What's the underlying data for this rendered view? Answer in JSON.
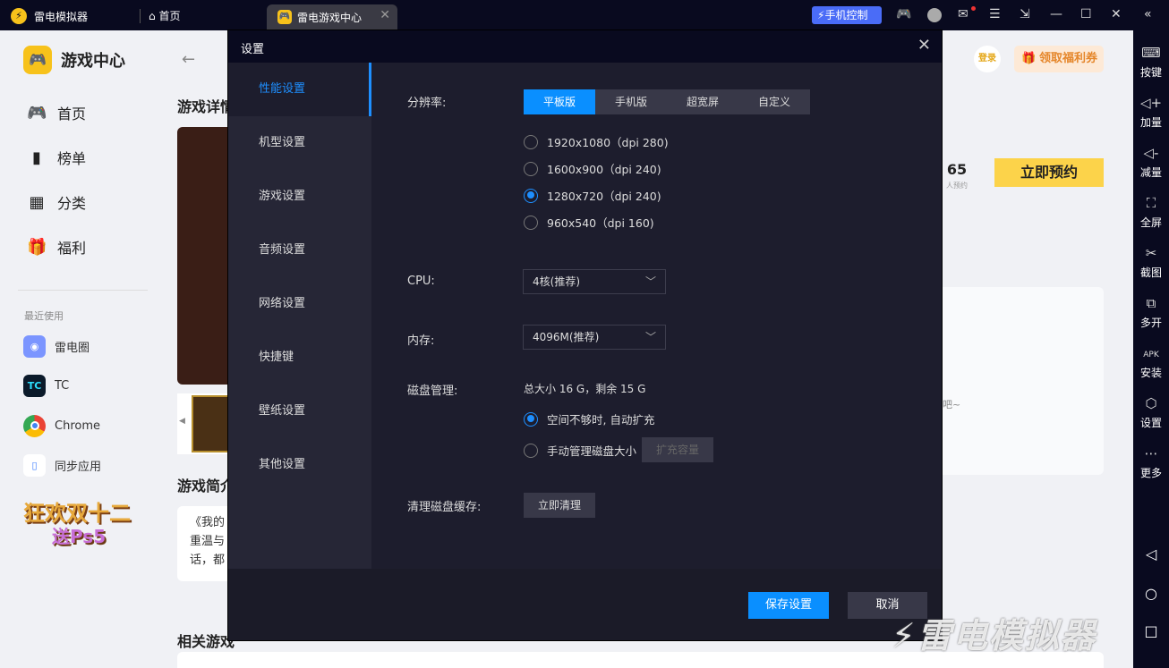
{
  "titlebar": {
    "app_name": "雷电模拟器",
    "home_tab": "首页",
    "active_tab": "雷电游戏中心",
    "phone_control": "手机控制"
  },
  "right_toolbar": [
    {
      "icon": "keyboard-icon",
      "label": "按键"
    },
    {
      "icon": "volume-up-icon",
      "label": "加量"
    },
    {
      "icon": "volume-down-icon",
      "label": "减量"
    },
    {
      "icon": "fullscreen-icon",
      "label": "全屏"
    },
    {
      "icon": "scissors-icon",
      "label": "截图"
    },
    {
      "icon": "multi-instance-icon",
      "label": "多开"
    },
    {
      "icon": "apk-install-icon",
      "label": "安装"
    },
    {
      "icon": "settings-icon",
      "label": "设置"
    },
    {
      "icon": "more-icon",
      "label": "更多"
    }
  ],
  "leftnav": {
    "brand": "游戏中心",
    "items": [
      {
        "icon": "gamepad-icon",
        "label": "首页"
      },
      {
        "icon": "ranking-icon",
        "label": "榜单"
      },
      {
        "icon": "category-icon",
        "label": "分类"
      },
      {
        "icon": "gift-icon",
        "label": "福利"
      }
    ],
    "recent_header": "最近使用",
    "recent": [
      {
        "label": "雷电圈",
        "color": "#6f8cff"
      },
      {
        "label": "TC",
        "color": "#0b1a2a"
      },
      {
        "label": "Chrome",
        "color": "#4285f4"
      },
      {
        "label": "同步应用",
        "color": "#3b7cff"
      }
    ],
    "promo_line1": "狂欢双十二",
    "promo_line2": "送Ps5"
  },
  "main": {
    "detail_header": "游戏详情",
    "intro_header": "游戏简介",
    "intro_lines": [
      "《我的",
      "重温与",
      "话，都"
    ],
    "related_header": "相关游戏",
    "login": "登录",
    "coupon": "领取福利券",
    "reserve_count": "65",
    "reserve_count_label": "人预约",
    "reserve_button": "立即预约",
    "panel_text": "吧~"
  },
  "dialog": {
    "title": "设置",
    "menu": [
      "性能设置",
      "机型设置",
      "游戏设置",
      "音频设置",
      "网络设置",
      "快捷键",
      "壁纸设置",
      "其他设置"
    ],
    "active_menu": 0,
    "resolution_label": "分辨率:",
    "resolution_tabs": [
      "平板版",
      "手机版",
      "超宽屏",
      "自定义"
    ],
    "resolutions": [
      "1920x1080（dpi 280)",
      "1600x900（dpi 240)",
      "1280x720（dpi 240)",
      "960x540（dpi 160)"
    ],
    "cpu_label": "CPU:",
    "cpu_value": "4核(推荐)",
    "memory_label": "内存:",
    "memory_value": "4096M(推荐)",
    "disk_label": "磁盘管理:",
    "disk_info": "总大小 16 G，剩余 15 G",
    "disk_auto": "空间不够时, 自动扩充",
    "disk_manual": "手动管理磁盘大小",
    "expand_button": "扩充容量",
    "cache_label": "清理磁盘缓存:",
    "clean_button": "立即清理",
    "save_button": "保存设置",
    "cancel_button": "取消"
  },
  "watermark": "雷电模拟器",
  "colors": {
    "accent": "#0a8fff",
    "yellow": "#fcd34a",
    "titlebar": "#090a1f"
  }
}
